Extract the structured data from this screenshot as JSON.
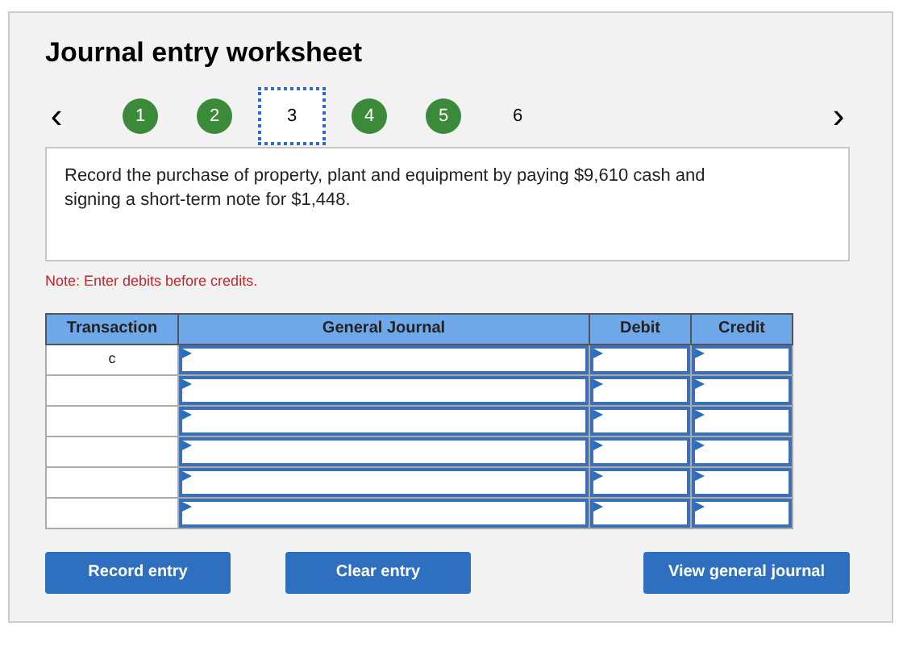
{
  "title": "Journal entry worksheet",
  "nav": {
    "prev": "‹",
    "next": "›"
  },
  "steps": [
    {
      "label": "1",
      "done": true,
      "selected": false
    },
    {
      "label": "2",
      "done": true,
      "selected": false
    },
    {
      "label": "3",
      "done": false,
      "selected": true
    },
    {
      "label": "4",
      "done": true,
      "selected": false
    },
    {
      "label": "5",
      "done": true,
      "selected": false
    },
    {
      "label": "6",
      "done": false,
      "selected": false
    }
  ],
  "description": "Record the purchase of property, plant and equipment by paying $9,610 cash and signing a short-term note for $1,448.",
  "note": "Note: Enter debits before credits.",
  "table": {
    "columns": [
      "Transaction",
      "General Journal",
      "Debit",
      "Credit"
    ],
    "rows": [
      {
        "transaction": "c"
      },
      {
        "transaction": ""
      },
      {
        "transaction": ""
      },
      {
        "transaction": ""
      },
      {
        "transaction": ""
      },
      {
        "transaction": ""
      }
    ]
  },
  "buttons": [
    "Record entry",
    "Clear entry",
    "View general journal"
  ]
}
